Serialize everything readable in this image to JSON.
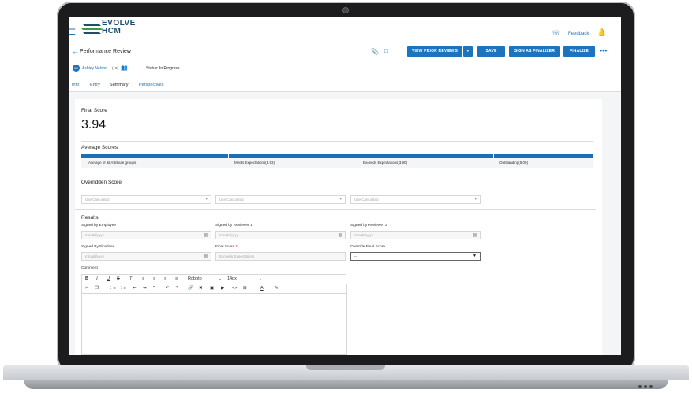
{
  "app": {
    "logo_line1": "EVOLVE",
    "logo_line2": "HCM",
    "feedback_label": "Feedback"
  },
  "header": {
    "title": "Performance Review",
    "buttons": {
      "view_prior_reviews": "VIEW PRIOR REVIEWS",
      "save": "SAVE",
      "sign_as_finalizer": "SIGN AS FINALIZER",
      "finalize": "FINALIZE"
    }
  },
  "user": {
    "initials": "AN",
    "name": "Ashley Nelson",
    "count": "(19)",
    "status": "Status: In Progress"
  },
  "tabs": [
    {
      "label": "Info"
    },
    {
      "label": "Entry"
    },
    {
      "label": "Summary",
      "active": true
    },
    {
      "label": "Perspectives"
    }
  ],
  "final_score": {
    "label": "Final Score",
    "value": "3.94"
  },
  "average_scores": {
    "title": "Average Scores",
    "cells": [
      "Average of all Attribute groups",
      "Meets Expectations(3.53)",
      "Exceeds Expectations(3.90)",
      "Outstanding(5.00)"
    ]
  },
  "overridden": {
    "title": "Overridden Score",
    "selects": [
      "Use Calculated",
      "Use Calculated",
      "Use Calculated"
    ]
  },
  "results": {
    "title": "Results",
    "signed_by_employee": {
      "label": "Signed by Employee",
      "placeholder": "mm/dd/yyyy"
    },
    "signed_by_reviewer1": {
      "label": "Signed by Reviewer 1",
      "placeholder": "mm/dd/yyyy"
    },
    "signed_by_reviewer2": {
      "label": "Signed by Reviewer 2",
      "placeholder": "mm/dd/yyyy"
    },
    "signed_by_finalizer": {
      "label": "Signed By Finalizer",
      "placeholder": "mm/dd/yyyy"
    },
    "final_score": {
      "label": "Final Score",
      "value": "Exceeds Expectations"
    },
    "override_final_score": {
      "label": "Override Final Score",
      "value": "--"
    }
  },
  "comment": {
    "label": "Comment",
    "font": "Roboto",
    "size": "14px"
  },
  "colors": {
    "accent": "#1e73be",
    "bar": "#1a6fb8"
  }
}
